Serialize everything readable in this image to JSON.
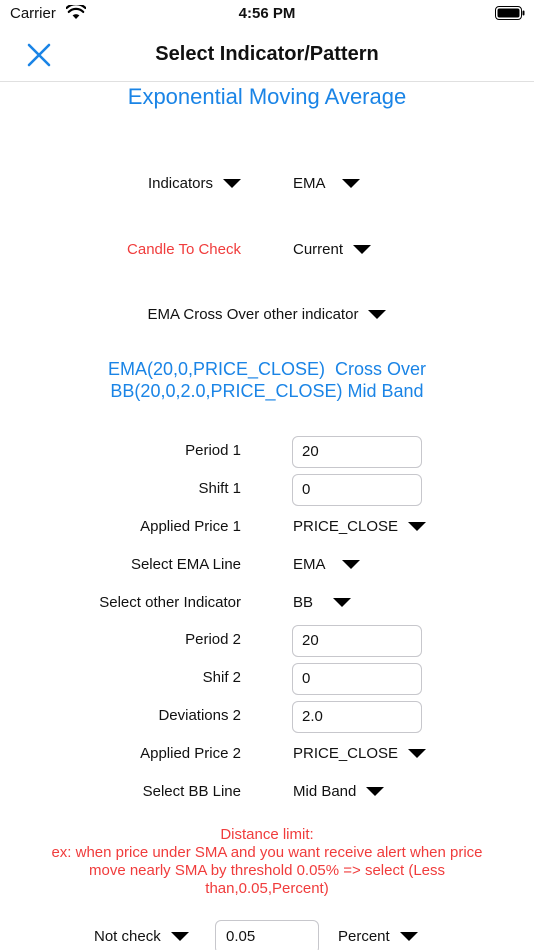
{
  "status_bar": {
    "carrier": "Carrier",
    "time": "4:56 PM"
  },
  "nav": {
    "title": "Select Indicator/Pattern",
    "close_icon": "close-icon"
  },
  "indicator_title": "Exponential Moving Average",
  "indicators": {
    "label": "Indicators",
    "value": "EMA"
  },
  "candle": {
    "label": "Candle To Check",
    "value": "Current"
  },
  "condition": {
    "value": "EMA Cross Over other indicator"
  },
  "expression": {
    "line1": "EMA(20,0,PRICE_CLOSE)  Cross Over",
    "line2": "BB(20,0,2.0,PRICE_CLOSE) Mid Band"
  },
  "params": {
    "period1": {
      "label": "Period 1",
      "value": "20"
    },
    "shift1": {
      "label": "Shift 1",
      "value": "0"
    },
    "applied_price1": {
      "label": "Applied Price 1",
      "value": "PRICE_CLOSE"
    },
    "ema_line": {
      "label": "Select EMA Line",
      "value": "EMA"
    },
    "other_indicator": {
      "label": "Select other Indicator",
      "value": "BB"
    },
    "period2": {
      "label": "Period 2",
      "value": "20"
    },
    "shift2": {
      "label": "Shif 2",
      "value": "0"
    },
    "deviations2": {
      "label": "Deviations 2",
      "value": "2.0"
    },
    "applied_price2": {
      "label": "Applied Price 2",
      "value": "PRICE_CLOSE"
    },
    "bb_line": {
      "label": "Select BB Line",
      "value": "Mid Band"
    }
  },
  "distance": {
    "line1": "Distance limit:",
    "line2": "ex: when price under SMA and you want receive alert when price",
    "line3": "move nearly SMA by threshold 0.05% => select (Less",
    "line4": "than,0.05,Percent)"
  },
  "bottom": {
    "check": "Not check",
    "threshold": "0.05",
    "unit": "Percent"
  },
  "colors": {
    "accent": "#1a84e6",
    "warning": "#f03c3c"
  }
}
